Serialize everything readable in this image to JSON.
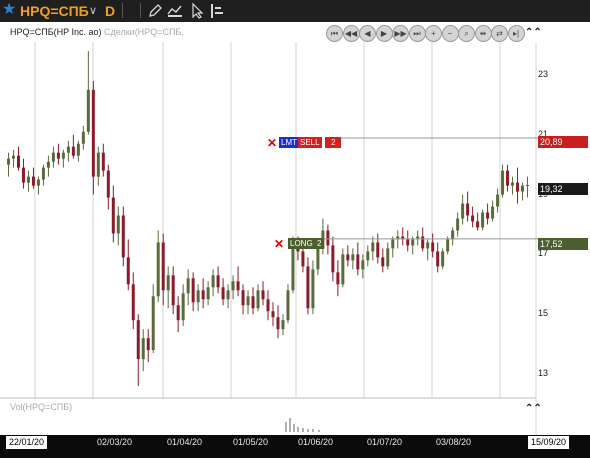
{
  "toolbar": {
    "ticker": "HPQ=СПБ",
    "timeframe": "D",
    "star_icon": "star-icon",
    "icons": [
      "pencil-icon",
      "drawing-tools-icon",
      "cursor-icon",
      "indicators-icon"
    ]
  },
  "chart": {
    "title": "HPQ=СПБ(HP Inc. ао)",
    "title_deals": "Сделки(HPQ=СПБ,",
    "volume_title": "Vol(HPQ=СПБ)",
    "nav_buttons": [
      "first",
      "prev-page",
      "prev",
      "next",
      "next-page",
      "last",
      "zoom-in",
      "zoom-out",
      "zoom-fit",
      "shrink",
      "expand",
      "scroll-end"
    ],
    "colors": {
      "up": "#596b3a",
      "down": "#8b1a2a",
      "sell": "#d42020",
      "long": "#4a5e2e",
      "lmt": "#2233cc",
      "bg": "#ffffff"
    }
  },
  "price_labels": {
    "sell_price": "20,89",
    "last_price": "19,32",
    "long_price": "17,52"
  },
  "orders": {
    "lmt": "LMT",
    "sell": "SELL",
    "sell_qty": "2",
    "long": "LONG",
    "long_qty": "2"
  },
  "x_axis": {
    "start_date": "22/01/20",
    "end_date": "15/09/20",
    "labels": [
      "02/03/20",
      "01/04/20",
      "01/05/20",
      "01/06/20",
      "01/07/20",
      "03/08/20"
    ]
  },
  "chart_data": {
    "type": "candlestick",
    "y_ticks": [
      "23",
      "21",
      "19",
      "17",
      "15",
      "13"
    ],
    "ylim": [
      12.4,
      24.1
    ],
    "series": [
      {
        "o": 20.0,
        "h": 20.4,
        "l": 19.6,
        "c": 20.2
      },
      {
        "o": 20.2,
        "h": 20.5,
        "l": 19.9,
        "c": 20.3
      },
      {
        "o": 20.3,
        "h": 20.6,
        "l": 19.8,
        "c": 19.9
      },
      {
        "o": 19.9,
        "h": 20.2,
        "l": 19.2,
        "c": 19.4
      },
      {
        "o": 19.4,
        "h": 19.8,
        "l": 19.1,
        "c": 19.6
      },
      {
        "o": 19.6,
        "h": 19.9,
        "l": 19.2,
        "c": 19.3
      },
      {
        "o": 19.3,
        "h": 19.6,
        "l": 19.0,
        "c": 19.5
      },
      {
        "o": 19.5,
        "h": 20.0,
        "l": 19.3,
        "c": 19.9
      },
      {
        "o": 19.9,
        "h": 20.3,
        "l": 19.6,
        "c": 20.1
      },
      {
        "o": 20.1,
        "h": 20.6,
        "l": 19.9,
        "c": 20.4
      },
      {
        "o": 20.4,
        "h": 20.7,
        "l": 20.0,
        "c": 20.2
      },
      {
        "o": 20.2,
        "h": 20.5,
        "l": 19.9,
        "c": 20.4
      },
      {
        "o": 20.4,
        "h": 20.8,
        "l": 20.1,
        "c": 20.6
      },
      {
        "o": 20.6,
        "h": 21.0,
        "l": 20.2,
        "c": 20.3
      },
      {
        "o": 20.3,
        "h": 20.8,
        "l": 20.1,
        "c": 20.7
      },
      {
        "o": 20.7,
        "h": 21.3,
        "l": 20.5,
        "c": 21.1
      },
      {
        "o": 21.1,
        "h": 23.8,
        "l": 21.0,
        "c": 22.5
      },
      {
        "o": 22.5,
        "h": 22.8,
        "l": 19.0,
        "c": 19.6
      },
      {
        "o": 19.6,
        "h": 20.6,
        "l": 19.3,
        "c": 20.4
      },
      {
        "o": 20.4,
        "h": 20.7,
        "l": 19.6,
        "c": 19.8
      },
      {
        "o": 19.8,
        "h": 20.0,
        "l": 18.5,
        "c": 18.9
      },
      {
        "o": 18.9,
        "h": 19.3,
        "l": 17.4,
        "c": 17.7
      },
      {
        "o": 17.7,
        "h": 18.6,
        "l": 17.3,
        "c": 18.3
      },
      {
        "o": 18.3,
        "h": 18.6,
        "l": 16.6,
        "c": 16.9
      },
      {
        "o": 16.9,
        "h": 17.5,
        "l": 15.8,
        "c": 16.0
      },
      {
        "o": 16.0,
        "h": 16.4,
        "l": 14.5,
        "c": 14.8
      },
      {
        "o": 14.8,
        "h": 15.0,
        "l": 12.6,
        "c": 13.5
      },
      {
        "o": 13.5,
        "h": 14.5,
        "l": 13.1,
        "c": 14.2
      },
      {
        "o": 14.2,
        "h": 14.5,
        "l": 13.4,
        "c": 13.8
      },
      {
        "o": 13.8,
        "h": 16.0,
        "l": 13.7,
        "c": 15.6
      },
      {
        "o": 15.6,
        "h": 17.8,
        "l": 15.4,
        "c": 17.4
      },
      {
        "o": 17.4,
        "h": 17.7,
        "l": 15.3,
        "c": 15.8
      },
      {
        "o": 15.8,
        "h": 16.6,
        "l": 15.2,
        "c": 16.3
      },
      {
        "o": 16.3,
        "h": 16.6,
        "l": 15.0,
        "c": 15.3
      },
      {
        "o": 15.3,
        "h": 15.6,
        "l": 14.4,
        "c": 14.8
      },
      {
        "o": 14.8,
        "h": 16.0,
        "l": 14.6,
        "c": 15.7
      },
      {
        "o": 15.7,
        "h": 16.5,
        "l": 15.3,
        "c": 16.2
      },
      {
        "o": 16.2,
        "h": 16.4,
        "l": 15.1,
        "c": 15.4
      },
      {
        "o": 15.4,
        "h": 16.0,
        "l": 15.1,
        "c": 15.8
      },
      {
        "o": 15.8,
        "h": 16.2,
        "l": 15.2,
        "c": 15.5
      },
      {
        "o": 15.5,
        "h": 16.1,
        "l": 15.3,
        "c": 15.9
      },
      {
        "o": 15.9,
        "h": 16.5,
        "l": 15.6,
        "c": 16.3
      },
      {
        "o": 16.3,
        "h": 16.6,
        "l": 15.7,
        "c": 15.9
      },
      {
        "o": 15.9,
        "h": 16.2,
        "l": 15.3,
        "c": 15.5
      },
      {
        "o": 15.5,
        "h": 16.0,
        "l": 15.2,
        "c": 15.8
      },
      {
        "o": 15.8,
        "h": 16.3,
        "l": 15.5,
        "c": 16.1
      },
      {
        "o": 16.1,
        "h": 16.6,
        "l": 15.6,
        "c": 15.8
      },
      {
        "o": 15.8,
        "h": 16.0,
        "l": 15.0,
        "c": 15.3
      },
      {
        "o": 15.3,
        "h": 15.8,
        "l": 15.0,
        "c": 15.6
      },
      {
        "o": 15.6,
        "h": 15.9,
        "l": 15.0,
        "c": 15.2
      },
      {
        "o": 15.2,
        "h": 16.0,
        "l": 15.1,
        "c": 15.8
      },
      {
        "o": 15.8,
        "h": 16.1,
        "l": 15.3,
        "c": 15.5
      },
      {
        "o": 15.5,
        "h": 15.8,
        "l": 14.8,
        "c": 15.1
      },
      {
        "o": 15.1,
        "h": 15.4,
        "l": 14.6,
        "c": 14.9
      },
      {
        "o": 14.9,
        "h": 15.3,
        "l": 14.2,
        "c": 14.5
      },
      {
        "o": 14.5,
        "h": 15.0,
        "l": 14.3,
        "c": 14.8
      },
      {
        "o": 14.8,
        "h": 16.0,
        "l": 14.7,
        "c": 15.8
      },
      {
        "o": 15.8,
        "h": 17.6,
        "l": 15.7,
        "c": 17.3
      },
      {
        "o": 17.3,
        "h": 17.6,
        "l": 16.8,
        "c": 17.1
      },
      {
        "o": 17.1,
        "h": 17.5,
        "l": 16.4,
        "c": 16.6
      },
      {
        "o": 16.6,
        "h": 16.9,
        "l": 15.0,
        "c": 15.2
      },
      {
        "o": 15.2,
        "h": 16.8,
        "l": 15.0,
        "c": 16.5
      },
      {
        "o": 16.5,
        "h": 17.5,
        "l": 16.3,
        "c": 17.2
      },
      {
        "o": 17.2,
        "h": 18.2,
        "l": 17.0,
        "c": 17.8
      },
      {
        "o": 17.8,
        "h": 18.0,
        "l": 17.0,
        "c": 17.3
      },
      {
        "o": 17.3,
        "h": 17.6,
        "l": 16.1,
        "c": 16.4
      },
      {
        "o": 16.4,
        "h": 16.8,
        "l": 15.6,
        "c": 16.0
      },
      {
        "o": 16.0,
        "h": 17.2,
        "l": 15.9,
        "c": 17.0
      },
      {
        "o": 17.0,
        "h": 17.3,
        "l": 16.6,
        "c": 16.8
      },
      {
        "o": 16.8,
        "h": 17.2,
        "l": 16.5,
        "c": 17.0
      },
      {
        "o": 17.0,
        "h": 17.4,
        "l": 16.3,
        "c": 16.5
      },
      {
        "o": 16.5,
        "h": 17.0,
        "l": 16.2,
        "c": 16.8
      },
      {
        "o": 16.8,
        "h": 17.3,
        "l": 16.6,
        "c": 17.1
      },
      {
        "o": 17.1,
        "h": 17.6,
        "l": 16.8,
        "c": 17.4
      },
      {
        "o": 17.4,
        "h": 17.7,
        "l": 16.7,
        "c": 16.9
      },
      {
        "o": 16.9,
        "h": 17.2,
        "l": 16.4,
        "c": 16.6
      },
      {
        "o": 16.6,
        "h": 17.4,
        "l": 16.5,
        "c": 17.2
      },
      {
        "o": 17.2,
        "h": 17.6,
        "l": 16.9,
        "c": 17.5
      },
      {
        "o": 17.5,
        "h": 17.8,
        "l": 17.2,
        "c": 17.6
      },
      {
        "o": 17.6,
        "h": 17.9,
        "l": 17.3,
        "c": 17.5
      },
      {
        "o": 17.5,
        "h": 17.8,
        "l": 17.1,
        "c": 17.3
      },
      {
        "o": 17.3,
        "h": 17.6,
        "l": 17.0,
        "c": 17.5
      },
      {
        "o": 17.5,
        "h": 17.8,
        "l": 17.3,
        "c": 17.6
      },
      {
        "o": 17.6,
        "h": 17.9,
        "l": 17.1,
        "c": 17.2
      },
      {
        "o": 17.2,
        "h": 17.5,
        "l": 16.8,
        "c": 17.4
      },
      {
        "o": 17.4,
        "h": 17.7,
        "l": 16.9,
        "c": 17.1
      },
      {
        "o": 17.1,
        "h": 17.4,
        "l": 16.4,
        "c": 16.6
      },
      {
        "o": 16.6,
        "h": 17.2,
        "l": 16.5,
        "c": 17.1
      },
      {
        "o": 17.1,
        "h": 17.6,
        "l": 17.0,
        "c": 17.5
      },
      {
        "o": 17.5,
        "h": 17.9,
        "l": 17.3,
        "c": 17.8
      },
      {
        "o": 17.8,
        "h": 18.4,
        "l": 17.6,
        "c": 18.2
      },
      {
        "o": 18.2,
        "h": 19.0,
        "l": 18.0,
        "c": 18.7
      },
      {
        "o": 18.7,
        "h": 19.1,
        "l": 18.1,
        "c": 18.3
      },
      {
        "o": 18.3,
        "h": 18.6,
        "l": 17.9,
        "c": 18.1
      },
      {
        "o": 18.1,
        "h": 18.4,
        "l": 17.8,
        "c": 17.9
      },
      {
        "o": 17.9,
        "h": 18.5,
        "l": 17.8,
        "c": 18.4
      },
      {
        "o": 18.4,
        "h": 18.7,
        "l": 18.0,
        "c": 18.2
      },
      {
        "o": 18.2,
        "h": 18.8,
        "l": 18.1,
        "c": 18.6
      },
      {
        "o": 18.6,
        "h": 19.2,
        "l": 18.4,
        "c": 19.0
      },
      {
        "o": 19.0,
        "h": 20.0,
        "l": 18.9,
        "c": 19.8
      },
      {
        "o": 19.8,
        "h": 20.0,
        "l": 19.1,
        "c": 19.3
      },
      {
        "o": 19.3,
        "h": 19.6,
        "l": 19.0,
        "c": 19.4
      },
      {
        "o": 19.4,
        "h": 19.9,
        "l": 18.7,
        "c": 19.1
      },
      {
        "o": 19.1,
        "h": 19.4,
        "l": 18.8,
        "c": 19.3
      },
      {
        "o": 19.3,
        "h": 19.6,
        "l": 18.9,
        "c": 19.32
      }
    ]
  }
}
